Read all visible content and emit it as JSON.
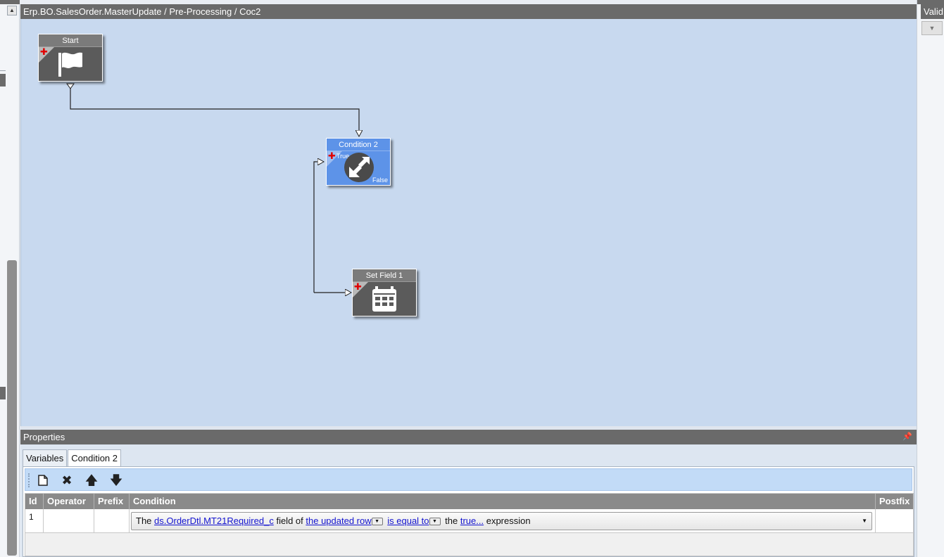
{
  "workflow": {
    "path": "Erp.BO.SalesOrder.MasterUpdate / Pre-Processing / Coc2",
    "nodes": {
      "start": {
        "title": "Start",
        "icon": "flag-icon"
      },
      "condition": {
        "title": "Condition 2",
        "icon": "condition-arrows-icon",
        "true_label": "True",
        "false_label": "False"
      },
      "set_field": {
        "title": "Set Field 1",
        "icon": "calendar-grid-icon"
      }
    }
  },
  "right_panel": {
    "title": "Valid"
  },
  "properties": {
    "title": "Properties",
    "tabs": [
      {
        "label": "Variables",
        "active": false
      },
      {
        "label": "Condition 2",
        "active": true
      }
    ],
    "toolbar": {
      "new": "new-document-icon",
      "delete": "delete-x-icon",
      "move_up": "arrow-up-icon",
      "move_down": "arrow-down-icon"
    },
    "grid": {
      "columns": [
        "Id",
        "Operator",
        "Prefix",
        "Condition",
        "Postfix"
      ],
      "rows": [
        {
          "id": "1",
          "operator": "",
          "prefix": "",
          "condition": {
            "t1": "The",
            "field": "ds.OrderDtl.MT21Required_c",
            "t2": "field of",
            "row": "the updated row",
            "op": "is equal to",
            "t3": "the",
            "value": "true...",
            "t4": "expression"
          },
          "postfix": ""
        }
      ]
    }
  }
}
